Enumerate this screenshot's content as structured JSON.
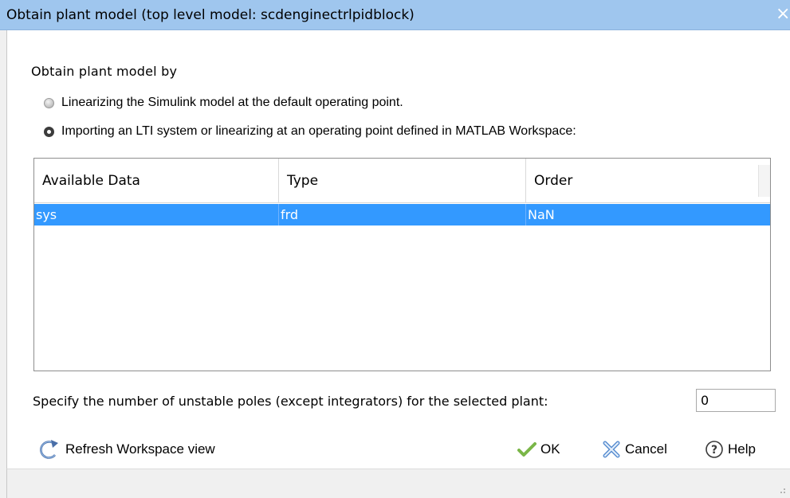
{
  "window": {
    "title": "Obtain plant model (top level model: scdenginectrlpidblock)",
    "close_glyph": "×"
  },
  "section": {
    "label": "Obtain plant model by"
  },
  "options": [
    {
      "label": "Linearizing the Simulink model at the default operating point.",
      "selected": false
    },
    {
      "label": "Importing an LTI system or linearizing at an operating point defined in MATLAB Workspace:",
      "selected": true
    }
  ],
  "table": {
    "columns": [
      "Available Data",
      "Type",
      "Order"
    ],
    "rows": [
      {
        "available_data": "sys",
        "type": "frd",
        "order": "NaN",
        "selected": true
      }
    ]
  },
  "poles": {
    "label": "Specify the number of unstable poles (except integrators) for the selected plant:",
    "value": "0"
  },
  "buttons": {
    "refresh": "Refresh Workspace view",
    "ok": "OK",
    "cancel": "Cancel",
    "help": "Help"
  },
  "icons": {
    "refresh": "refresh-arrow-icon",
    "ok": "green-check-icon",
    "cancel": "blue-x-icon",
    "help": "question-circle-icon"
  },
  "colors": {
    "title_bar": "#9fc6ee",
    "selection": "#3399ff",
    "ok_check": "#7ab648",
    "cancel_x": "#5b8fd1"
  }
}
